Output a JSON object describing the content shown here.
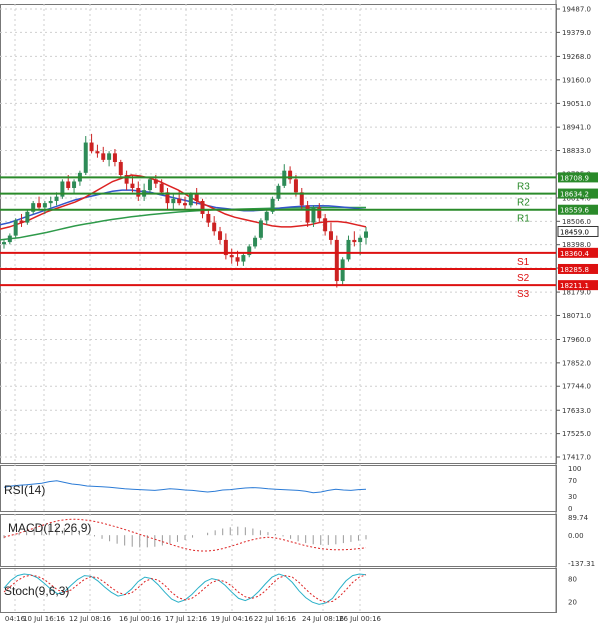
{
  "colors": {
    "background": "#ffffff",
    "grid": "#cfcfcf",
    "bull": "#2e8b57",
    "bear": "#cc2222",
    "resistance": "#2a8a2a",
    "support": "#dd1111",
    "ma_fast": "#dd2222",
    "ma_mid": "#3355cc",
    "ma_slow": "#2e9a4a",
    "rsi": "#2b7bd6",
    "macd_signal": "#dd2222",
    "macd_hist": "#999999",
    "stoch_k": "#2ab0c8",
    "stoch_d": "#dd2222"
  },
  "chart_data": {
    "type": "candlestick",
    "y_ticks": [
      "19487.0",
      "19379.0",
      "19268.0",
      "19160.0",
      "19051.0",
      "18941.0",
      "18833.0",
      "18725.0",
      "18614.0",
      "18506.0",
      "18398.0",
      "18290.0",
      "18179.0",
      "18071.0",
      "17960.0",
      "17852.0",
      "17744.0",
      "17633.0",
      "17525.0",
      "17417.0"
    ],
    "x_ticks": [
      "04:16",
      "10 Jul 16:16",
      "12 Jul 08:16",
      "16 Jul 00:16",
      "17 Jul 12:16",
      "19 Jul 04:16",
      "22 Jul 16:16",
      "24 Jul 08:16",
      "26 Jul 00:16"
    ],
    "ylim": [
      17417,
      19487
    ],
    "levels": [
      {
        "name": "R3",
        "value": 18708.9,
        "label": "18708.9",
        "kind": "resistance"
      },
      {
        "name": "R2",
        "value": 18634.2,
        "label": "18634.2",
        "kind": "resistance"
      },
      {
        "name": "R1",
        "value": 18559.6,
        "label": "18559.6",
        "kind": "resistance"
      },
      {
        "name": "S1",
        "value": 18360.4,
        "label": "18360.4",
        "kind": "support"
      },
      {
        "name": "S2",
        "value": 18285.8,
        "label": "18285.8",
        "kind": "support"
      },
      {
        "name": "S3",
        "value": 18211.1,
        "label": "18211.1",
        "kind": "support"
      }
    ],
    "last_price": {
      "value": 18459.0,
      "label": "18459.0"
    },
    "candles": [
      [
        18400,
        18420,
        18380,
        18410
      ],
      [
        18410,
        18450,
        18400,
        18440
      ],
      [
        18440,
        18520,
        18430,
        18510
      ],
      [
        18510,
        18540,
        18480,
        18500
      ],
      [
        18500,
        18560,
        18490,
        18550
      ],
      [
        18550,
        18600,
        18540,
        18590
      ],
      [
        18590,
        18620,
        18560,
        18570
      ],
      [
        18570,
        18600,
        18540,
        18590
      ],
      [
        18590,
        18620,
        18570,
        18600
      ],
      [
        18600,
        18640,
        18580,
        18620
      ],
      [
        18620,
        18700,
        18610,
        18690
      ],
      [
        18690,
        18720,
        18650,
        18660
      ],
      [
        18660,
        18700,
        18630,
        18690
      ],
      [
        18690,
        18740,
        18670,
        18730
      ],
      [
        18730,
        18900,
        18720,
        18870
      ],
      [
        18870,
        18910,
        18820,
        18830
      ],
      [
        18830,
        18860,
        18800,
        18820
      ],
      [
        18820,
        18850,
        18780,
        18790
      ],
      [
        18790,
        18830,
        18760,
        18820
      ],
      [
        18820,
        18840,
        18760,
        18780
      ],
      [
        18780,
        18790,
        18700,
        18720
      ],
      [
        18720,
        18740,
        18650,
        18680
      ],
      [
        18680,
        18720,
        18640,
        18660
      ],
      [
        18660,
        18690,
        18600,
        18620
      ],
      [
        18620,
        18680,
        18600,
        18650
      ],
      [
        18650,
        18710,
        18640,
        18700
      ],
      [
        18700,
        18720,
        18660,
        18680
      ],
      [
        18680,
        18700,
        18630,
        18640
      ],
      [
        18640,
        18660,
        18560,
        18590
      ],
      [
        18590,
        18630,
        18560,
        18610
      ],
      [
        18610,
        18650,
        18580,
        18590
      ],
      [
        18590,
        18620,
        18560,
        18580
      ],
      [
        18580,
        18640,
        18570,
        18630
      ],
      [
        18630,
        18660,
        18580,
        18600
      ],
      [
        18600,
        18610,
        18520,
        18540
      ],
      [
        18540,
        18560,
        18480,
        18500
      ],
      [
        18500,
        18530,
        18440,
        18460
      ],
      [
        18460,
        18480,
        18400,
        18420
      ],
      [
        18420,
        18450,
        18330,
        18350
      ],
      [
        18350,
        18380,
        18310,
        18340
      ],
      [
        18340,
        18370,
        18300,
        18320
      ],
      [
        18320,
        18360,
        18300,
        18350
      ],
      [
        18350,
        18400,
        18340,
        18390
      ],
      [
        18390,
        18440,
        18380,
        18430
      ],
      [
        18430,
        18520,
        18420,
        18510
      ],
      [
        18510,
        18560,
        18490,
        18550
      ],
      [
        18550,
        18620,
        18540,
        18610
      ],
      [
        18610,
        18680,
        18600,
        18670
      ],
      [
        18670,
        18770,
        18660,
        18740
      ],
      [
        18740,
        18760,
        18680,
        18700
      ],
      [
        18700,
        18720,
        18620,
        18640
      ],
      [
        18640,
        18660,
        18560,
        18580
      ],
      [
        18580,
        18600,
        18480,
        18500
      ],
      [
        18500,
        18580,
        18480,
        18570
      ],
      [
        18570,
        18590,
        18500,
        18520
      ],
      [
        18520,
        18540,
        18440,
        18460
      ],
      [
        18460,
        18500,
        18400,
        18420
      ],
      [
        18420,
        18440,
        18200,
        18230
      ],
      [
        18230,
        18340,
        18210,
        18330
      ],
      [
        18330,
        18440,
        18320,
        18420
      ],
      [
        18420,
        18460,
        18390,
        18410
      ],
      [
        18410,
        18440,
        18350,
        18430
      ],
      [
        18430,
        18480,
        18400,
        18459
      ]
    ],
    "ma_fast": [
      18470,
      18480,
      18495,
      18510,
      18530,
      18550,
      18565,
      18580,
      18595,
      18615,
      18640,
      18665,
      18690,
      18705,
      18720,
      18715,
      18705,
      18690,
      18670,
      18650,
      18625,
      18600,
      18580,
      18560,
      18540,
      18525,
      18515,
      18505,
      18495,
      18485,
      18480,
      18480,
      18485,
      18490,
      18500,
      18505,
      18505,
      18500,
      18490,
      18480
    ],
    "ma_mid": [
      18490,
      18500,
      18515,
      18530,
      18545,
      18560,
      18575,
      18590,
      18605,
      18615,
      18625,
      18635,
      18645,
      18650,
      18650,
      18645,
      18640,
      18630,
      18620,
      18610,
      18600,
      18590,
      18580,
      18570,
      18565,
      18560,
      18555,
      18555,
      18558,
      18562,
      18568,
      18572,
      18575,
      18577,
      18578,
      18577,
      18574,
      18570,
      18565,
      18560
    ],
    "ma_slow": [
      18420,
      18425,
      18430,
      18438,
      18446,
      18455,
      18465,
      18475,
      18485,
      18493,
      18500,
      18508,
      18515,
      18521,
      18527,
      18532,
      18537,
      18541,
      18545,
      18549,
      18552,
      18555,
      18557,
      18560,
      18561,
      18562,
      18563,
      18564,
      18565,
      18566,
      18567,
      18568,
      18568,
      18569,
      18570,
      18570,
      18570,
      18570,
      18570,
      18570
    ],
    "indicators": [
      {
        "name": "RSI(14)",
        "ticks": [
          "100",
          "70",
          "30",
          "0"
        ],
        "range": [
          0,
          100
        ],
        "values": [
          52,
          55,
          57,
          58,
          60,
          62,
          66,
          68,
          64,
          60,
          58,
          55,
          54,
          53,
          52,
          50,
          48,
          47,
          46,
          45,
          44,
          46,
          48,
          47,
          45,
          44,
          42,
          40,
          42,
          45,
          46,
          48,
          50,
          51,
          50,
          48,
          47,
          46,
          45,
          44,
          42,
          38,
          40,
          44,
          47,
          45,
          44,
          46,
          47
        ]
      },
      {
        "name": "MACD(12,26,9)",
        "ticks": [
          "89.74",
          "0.00",
          "-137.31"
        ],
        "range": [
          -137.31,
          89.74
        ],
        "signal": [
          -10,
          0,
          10,
          22,
          35,
          48,
          60,
          70,
          76,
          79,
          78,
          74,
          68,
          60,
          50,
          40,
          28,
          16,
          4,
          -8,
          -20,
          -32,
          -44,
          -56,
          -66,
          -74,
          -78,
          -78,
          -74,
          -66,
          -56,
          -44,
          -32,
          -22,
          -14,
          -10,
          -14,
          -22,
          -32,
          -42,
          -52,
          -60,
          -66,
          -70,
          -72,
          -72,
          -70,
          -66,
          -62
        ],
        "hist": [
          -5,
          0,
          4,
          8,
          12,
          14,
          15,
          14,
          12,
          9,
          6,
          2,
          -2,
          -6,
          -10,
          -14,
          -17,
          -19,
          -20,
          -20,
          -19,
          -17,
          -14,
          -11,
          -8,
          -4,
          0,
          4,
          8,
          11,
          13,
          14,
          13,
          11,
          8,
          5,
          2,
          -2,
          -6,
          -10,
          -13,
          -15,
          -16,
          -16,
          -15,
          -13,
          -11,
          -9,
          -7
        ]
      },
      {
        "name": "Stoch(9,6,3)",
        "ticks": [
          "80",
          "20"
        ],
        "range": [
          0,
          100
        ],
        "k": [
          55,
          75,
          88,
          92,
          90,
          82,
          68,
          52,
          40,
          45,
          62,
          78,
          88,
          86,
          74,
          58,
          44,
          34,
          38,
          52,
          72,
          84,
          80,
          64,
          44,
          26,
          18,
          24,
          38,
          56,
          72,
          80,
          76,
          62,
          44,
          28,
          22,
          30,
          46,
          66,
          84,
          92,
          86,
          70,
          48,
          30,
          18,
          12,
          16,
          28,
          52,
          74,
          88,
          92,
          90
        ],
        "d": [
          45,
          60,
          75,
          85,
          89,
          86,
          78,
          64,
          50,
          44,
          50,
          64,
          78,
          85,
          82,
          70,
          56,
          44,
          38,
          42,
          56,
          72,
          80,
          76,
          62,
          44,
          30,
          24,
          28,
          40,
          56,
          70,
          76,
          72,
          60,
          44,
          32,
          28,
          34,
          48,
          66,
          82,
          88,
          84,
          70,
          52,
          36,
          24,
          18,
          20,
          32,
          50,
          70,
          84,
          90
        ]
      }
    ],
    "grid": true
  }
}
